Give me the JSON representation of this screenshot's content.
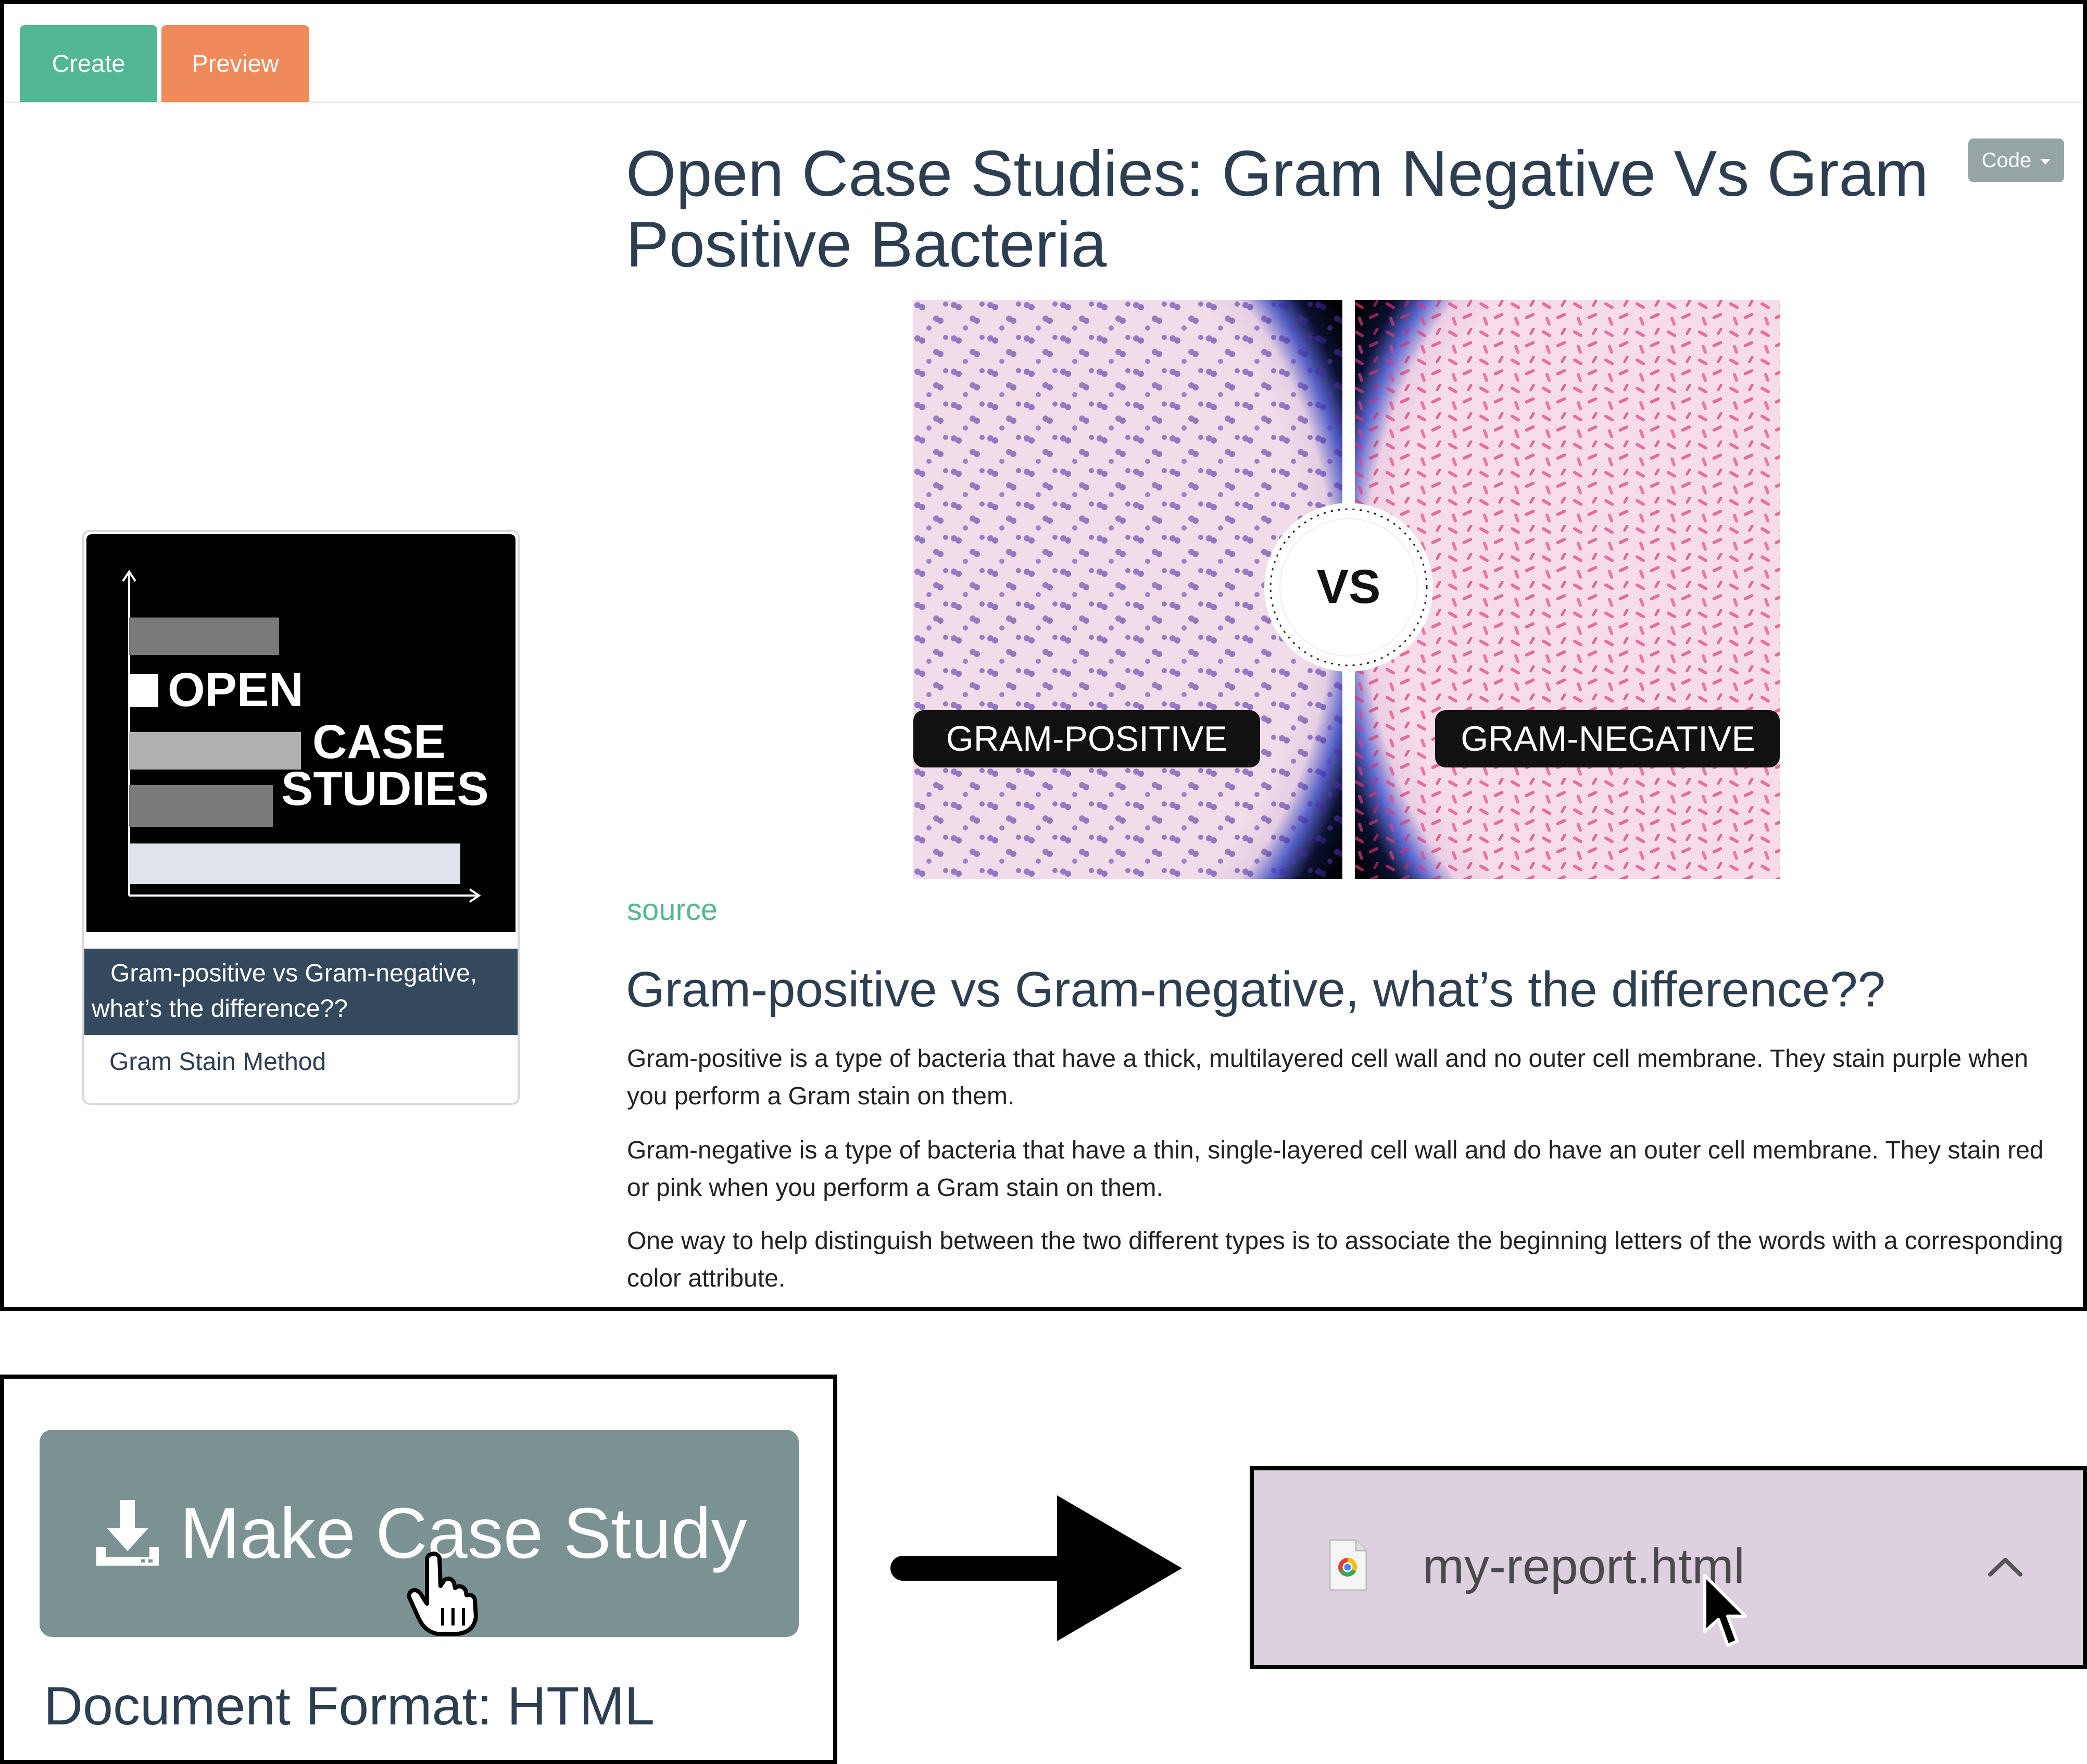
{
  "tabs": [
    {
      "label": "Create",
      "color": "#52b795"
    },
    {
      "label": "Preview",
      "color": "#f08a5a"
    }
  ],
  "code_button": {
    "label": "Code"
  },
  "main": {
    "title": "Open Case Studies: Gram Negative Vs Gram Positive Bacteria",
    "hero_image": {
      "left_label": "GRAM-POSITIVE",
      "right_label": "GRAM-NEGATIVE",
      "center_badge": "VS"
    },
    "source_link": "source",
    "subheading": "Gram-positive vs Gram-negative, what’s the difference??",
    "paragraphs": [
      "Gram-positive is a type of bacteria that have a thick, multilayered cell wall and no outer cell membrane. They stain purple when you perform a Gram stain on them.",
      "Gram-negative is a type of bacteria that have a thin, single-layered cell wall and do have an outer cell membrane. They stain red or pink when you perform a Gram stain on them.",
      "One way to help distinguish between the two different types is to associate the beginning letters of the words with a corresponding color attribute."
    ]
  },
  "card": {
    "logo_lines": [
      "OPEN",
      "CASE",
      "STUDIES"
    ],
    "caption_lines": [
      "Gram-positive vs Gram-negative,",
      "what’s the difference??"
    ],
    "link": "Gram Stain Method"
  },
  "make_case_study": {
    "button_label": "Make Case Study",
    "format_label": "Document Format: HTML"
  },
  "download": {
    "file_name": "my-report.html"
  },
  "colors": {
    "accent_green": "#52b795",
    "accent_orange": "#f08a5a",
    "heading": "#2c3e50",
    "caption_bg": "#34495e",
    "download_bar": "#ddd0df",
    "make_button": "#7a9392"
  },
  "icons": [
    "caret-down-icon",
    "download-icon",
    "hand-cursor-icon",
    "right-arrow-icon",
    "chrome-file-icon",
    "chevron-up-icon",
    "pointer-cursor-icon"
  ]
}
